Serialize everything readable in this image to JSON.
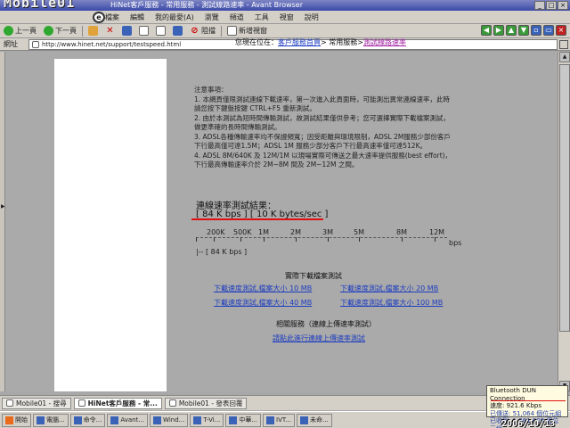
{
  "window": {
    "title": "HiNet客戶服務 - 常用服務 - 測試線路速率 - Avant Browser",
    "watermark": "Mobile01",
    "controls": [
      "_",
      "□",
      "×"
    ]
  },
  "menu": [
    "檔案",
    "編輯",
    "我的最愛(A)",
    "瀏覽",
    "頻道",
    "工具",
    "視窗",
    "說明"
  ],
  "toolbar": {
    "back": "上一頁",
    "forward": "下一頁",
    "block": "阻擋",
    "new_window": "新增視窗"
  },
  "address": {
    "label": "網址",
    "url": "http://www.hinet.net/support/testspeed.html"
  },
  "page": {
    "breadcrumb_prefix": "您現在位在：",
    "breadcrumb_home": "客戶服務首頁",
    "breadcrumb_sep1": "> 常用服務>",
    "breadcrumb_current": "測試線路速率",
    "notes_title": "注意事項：",
    "notes": [
      "1. 本網頁僅限測試連線下載速率，第一次進入此頁面時，可能測出異常連線速率，此時請您按下鍵盤按鍵 CTRL+F5 重新測試。",
      "2. 由於本測試為短時間傳輸測試，故測試結果僅供參考；您可選擇實際下載檔案測試，做更準確的長時間傳輸測試。",
      "3. ADSL各種傳輸速率均不保證頻寬；因受距離與環境限制，ADSL 2M服務少部份客戶下行最高僅可達1.5M；ADSL 1M 服務少部分客戶下行最高速率僅可達512K。",
      "4. ADSL 8M/640K 及 12M/1M 以現場實際可傳送之最大速率提供服務(best effort)，下行最高傳輸速率介於 2M~8M 間及 2M~12M 之間。"
    ],
    "result_title": "連線速率測試結果：",
    "result_value": "[ 84 K bps ] [ 10 K bytes/sec ]",
    "scale_labels": [
      "200K",
      "500K",
      "1M",
      "2M",
      "3M",
      "5M",
      "8M",
      "12M"
    ],
    "scale_unit": "bps",
    "scale_result": "|-- [ 84 K bps ]",
    "download_title": "實際下載檔案測試",
    "download_links": [
      "下載速度測試,檔案大小 10 MB",
      "下載速度測試,檔案大小 20 MB",
      "下載速度測試,檔案大小 40 MB",
      "下載速度測試,檔案大小 100 MB"
    ],
    "related_title": "相關服務（連線上傳速率測試）",
    "related_link": "請點此進行連線上傳速率測試"
  },
  "tabs": [
    {
      "label": "Mobile01 - 搜尋",
      "active": false
    },
    {
      "label": "HiNet客戶服務 - 常...",
      "active": true
    },
    {
      "label": "Mobile01 - 發表回覆",
      "active": false
    }
  ],
  "taskbar": [
    {
      "label": "開始",
      "start": true
    },
    {
      "label": "電腦..."
    },
    {
      "label": "命令..."
    },
    {
      "label": "Avant..."
    },
    {
      "label": "Wind..."
    },
    {
      "label": "T-Vi..."
    },
    {
      "label": "中華..."
    },
    {
      "label": "IVT..."
    },
    {
      "label": "未命..."
    }
  ],
  "balloon": {
    "title": "Bluetooth DUN Connection",
    "speed": "速度: 921.6 Kbps",
    "sent": "已傳送: 51,064 個位元組",
    "received": "已收到: 1,361,009 個位元組"
  },
  "stamp": "2006/10/13"
}
